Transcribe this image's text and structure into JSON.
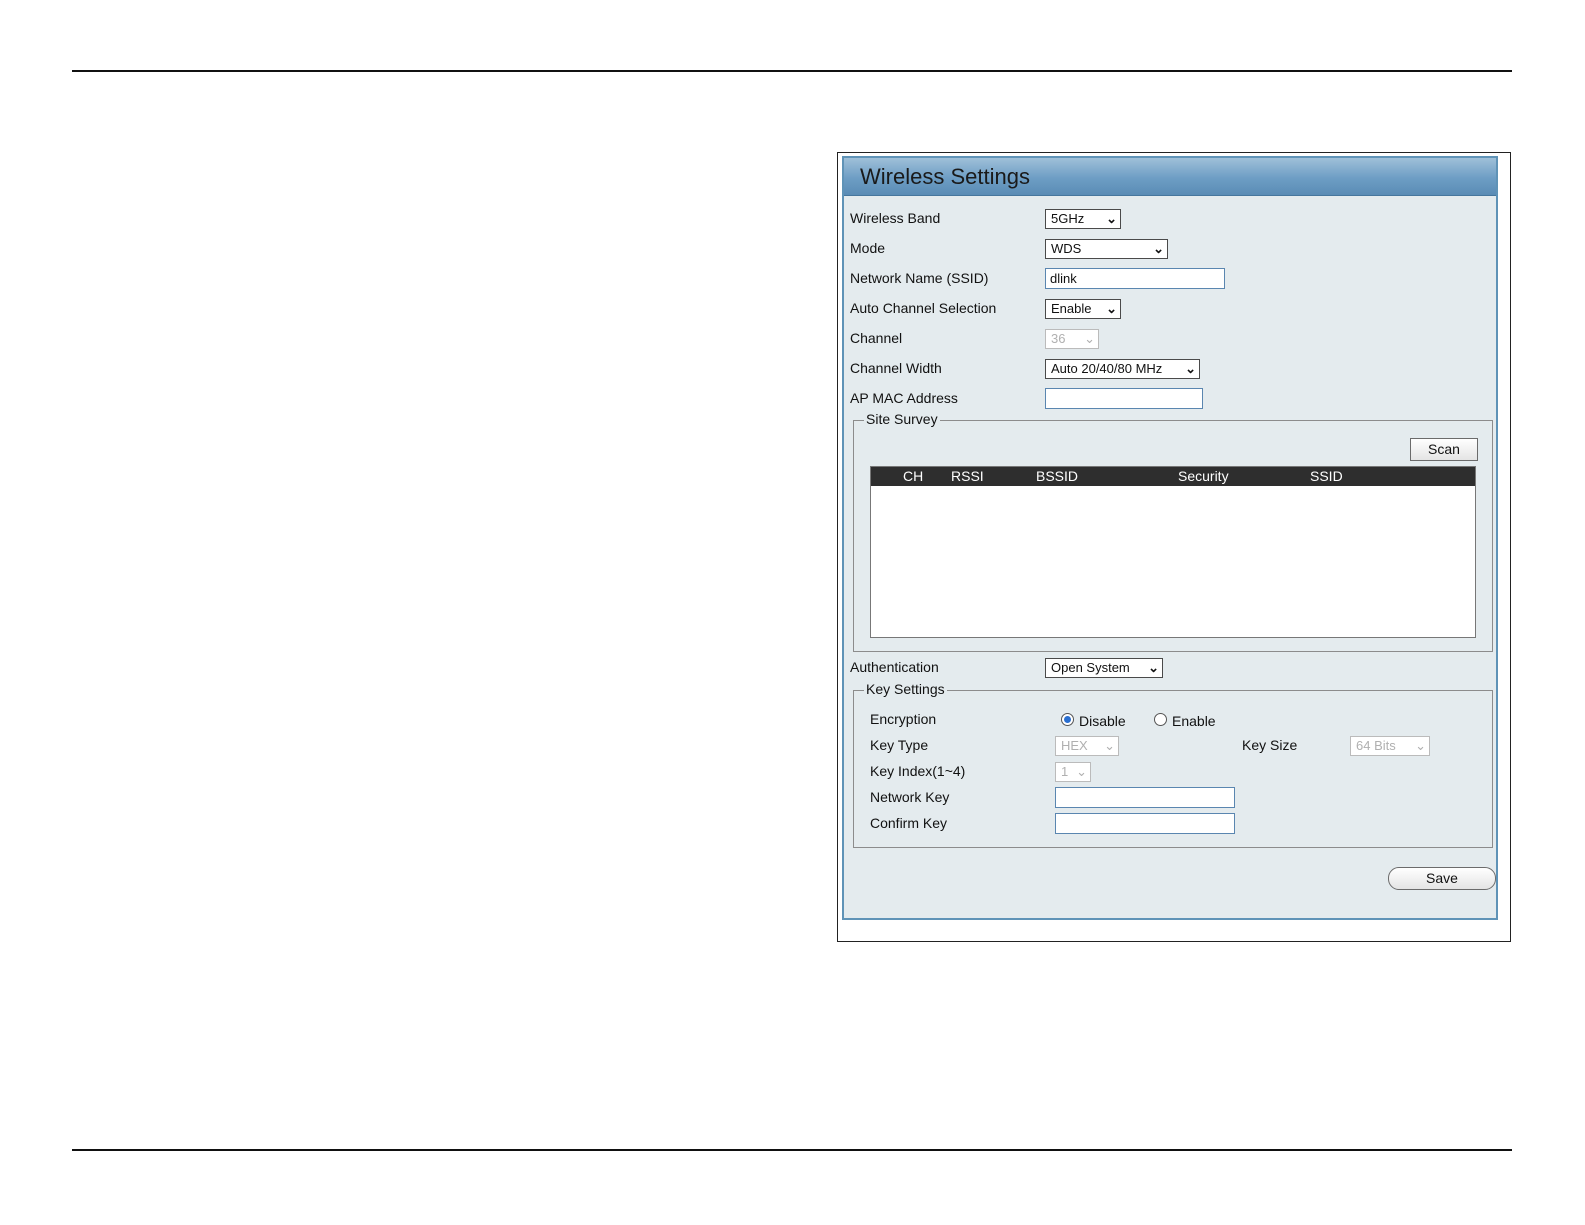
{
  "panel": {
    "title": "Wireless Settings"
  },
  "fields": {
    "wireless_band": {
      "label": "Wireless Band",
      "value": "5GHz"
    },
    "mode": {
      "label": "Mode",
      "value": "WDS"
    },
    "ssid": {
      "label": "Network Name (SSID)",
      "value": "dlink"
    },
    "auto_channel": {
      "label": "Auto Channel Selection",
      "value": "Enable"
    },
    "channel": {
      "label": "Channel",
      "value": "36"
    },
    "channel_width": {
      "label": "Channel Width",
      "value": "Auto 20/40/80 MHz"
    },
    "ap_mac": {
      "label": "AP MAC Address",
      "value": ""
    },
    "authentication": {
      "label": "Authentication",
      "value": "Open System"
    }
  },
  "site_survey": {
    "legend": "Site Survey",
    "scan_label": "Scan",
    "columns": [
      "CH",
      "RSSI",
      "BSSID",
      "Security",
      "SSID"
    ],
    "rows": []
  },
  "key_settings": {
    "legend": "Key Settings",
    "encryption": {
      "label": "Encryption",
      "options": [
        "Disable",
        "Enable"
      ],
      "selected": "Disable"
    },
    "key_type": {
      "label": "Key Type",
      "value": "HEX"
    },
    "key_size": {
      "label": "Key Size",
      "value": "64 Bits"
    },
    "key_index": {
      "label": "Key Index(1~4)",
      "value": "1"
    },
    "network_key": {
      "label": "Network Key",
      "value": ""
    },
    "confirm_key": {
      "label": "Confirm Key",
      "value": ""
    }
  },
  "actions": {
    "save_label": "Save"
  },
  "icons": {
    "dropdown": "chevron-down-icon",
    "radio_selected": "radio-selected-icon"
  },
  "colors": {
    "title_bar": "#6d9dc4",
    "panel_bg": "#e4ebee",
    "table_header": "#2e2e2e"
  }
}
